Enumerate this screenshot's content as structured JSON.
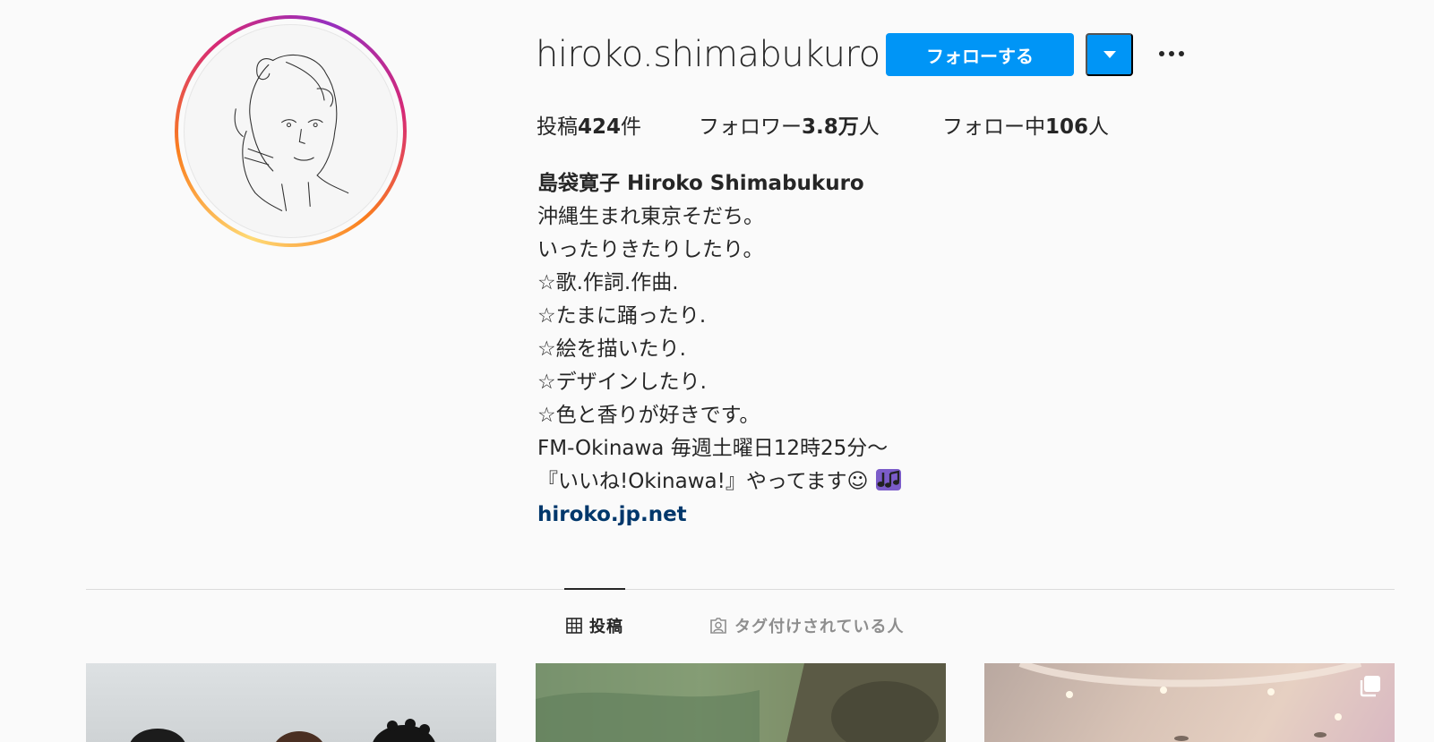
{
  "profile": {
    "username": "hiroko.shimabukuro",
    "follow_label": "フォローする"
  },
  "stats": {
    "posts_prefix": "投稿",
    "posts_count": "424",
    "posts_suffix": "件",
    "followers_prefix": "フォロワー",
    "followers_count": "3.8万",
    "followers_suffix": "人",
    "following_prefix": "フォロー中",
    "following_count": "106",
    "following_suffix": "人"
  },
  "bio": {
    "name": "島袋寛子 Hiroko Shimabukuro",
    "lines": [
      "沖縄生まれ東京そだち。",
      "いったりきたりしたり。",
      "☆歌.作詞.作曲.",
      "☆たまに踊ったり.",
      "☆絵を描いたり.",
      "☆デザインしたり.",
      "☆色と香りが好きです。",
      "FM-Okinawa 毎週土曜日12時25分〜",
      "『いいね!Okinawa!』やってます☺"
    ],
    "link": "hiroko.jp.net"
  },
  "tabs": {
    "posts": "投稿",
    "tagged": "タグ付けされている人"
  },
  "colors": {
    "primary_button": "#0095f6",
    "link": "#00376b",
    "background": "#fafafa"
  },
  "icons": {
    "more": "more-horizontal-icon",
    "dropdown": "chevron-down-icon",
    "posts_tab": "grid-icon",
    "tagged_tab": "tagged-user-icon",
    "music": "music-notes-icon",
    "multiple_posts": "carousel-icon"
  }
}
